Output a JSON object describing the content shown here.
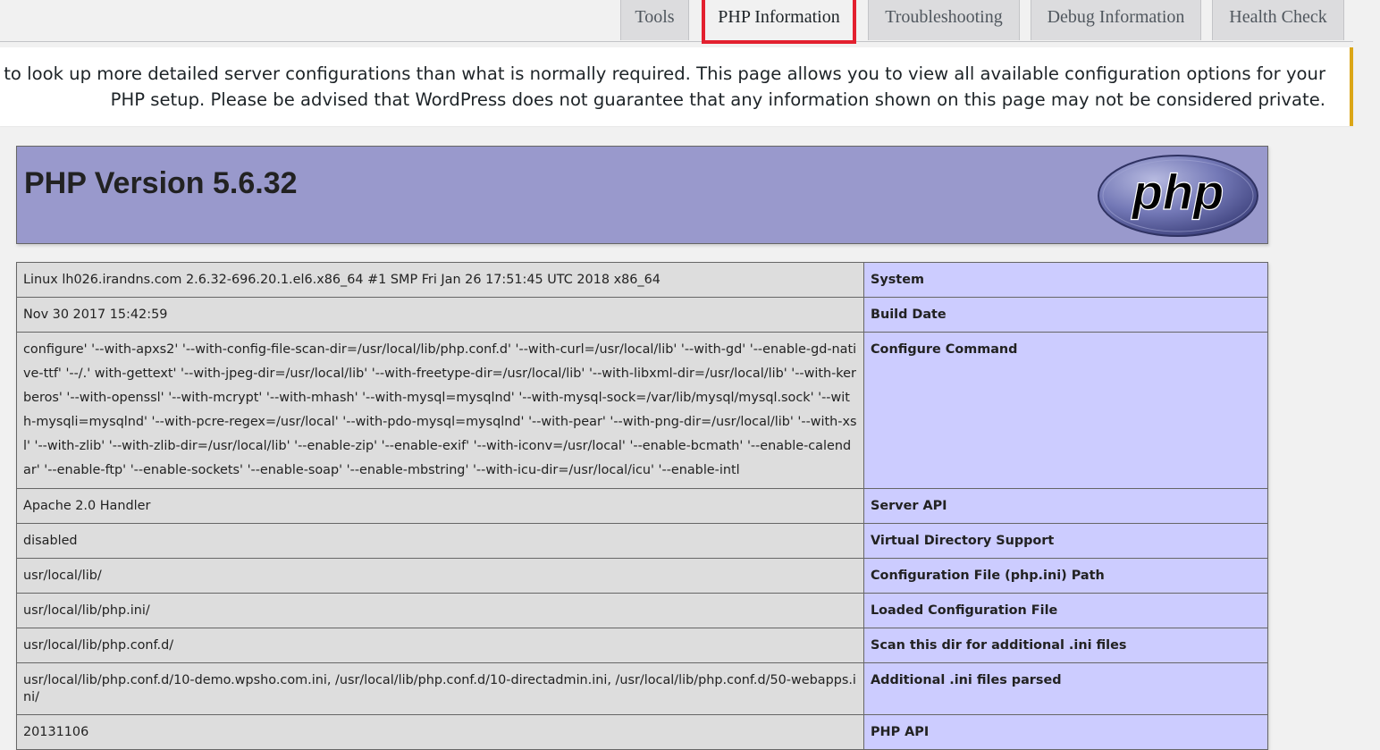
{
  "tabs": {
    "items": [
      {
        "label": "Tools"
      },
      {
        "label": "PHP Information"
      },
      {
        "label": "Troubleshooting"
      },
      {
        "label": "Debug Information"
      },
      {
        "label": "Health Check"
      }
    ],
    "active": "PHP Information"
  },
  "notice": {
    "line1": "scenarios require you to look up more detailed server configurations than what is normally required. This page allows you to view all available configuration options for your",
    "line2": ".PHP setup. Please be advised that WordPress does not guarantee that any information shown on this page may not be considered private"
  },
  "phpinfo": {
    "title": "PHP Version 5.6.32",
    "logo_text": "php",
    "colors": {
      "header_bg": "#9999cc",
      "key_bg": "#ccccff",
      "value_bg": "#dddddd",
      "notice_border": "#dba617",
      "highlight": "#e3202f"
    },
    "rows": [
      {
        "key": "System",
        "value": "Linux lh026.irandns.com 2.6.32-696.20.1.el6.x86_64 #1 SMP Fri Jan 26 17:51:45 UTC 2018 x86_64"
      },
      {
        "key": "Build Date",
        "value": "Nov 30 2017 15:42:59"
      },
      {
        "key": "Configure Command",
        "value": "configure' '--with-apxs2' '--with-config-file-scan-dir=/usr/local/lib/php.conf.d' '--with-curl=/usr/local/lib' '--with-gd' '--enable-gd-native-ttf' '--/.' with-gettext' '--with-jpeg-dir=/usr/local/lib' '--with-freetype-dir=/usr/local/lib' '--with-libxml-dir=/usr/local/lib' '--with-kerberos' '--with-openssl' '--with-mcrypt' '--with-mhash' '--with-mysql=mysqlnd' '--with-mysql-sock=/var/lib/mysql/mysql.sock' '--with-mysqli=mysqlnd' '--with-pcre-regex=/usr/local' '--with-pdo-mysql=mysqlnd' '--with-pear' '--with-png-dir=/usr/local/lib' '--with-xsl' '--with-zlib' '--with-zlib-dir=/usr/local/lib' '--enable-zip' '--enable-exif' '--with-iconv=/usr/local' '--enable-bcmath' '--enable-calendar' '--enable-ftp' '--enable-sockets' '--enable-soap' '--enable-mbstring' '--with-icu-dir=/usr/local/icu' '--enable-intl"
      },
      {
        "key": "Server API",
        "value": "Apache 2.0 Handler"
      },
      {
        "key": "Virtual Directory Support",
        "value": "disabled"
      },
      {
        "key": "Configuration File (php.ini) Path",
        "value": "usr/local/lib/"
      },
      {
        "key": "Loaded Configuration File",
        "value": "usr/local/lib/php.ini/"
      },
      {
        "key": "Scan this dir for additional .ini files",
        "value": "usr/local/lib/php.conf.d/"
      },
      {
        "key": "Additional .ini files parsed",
        "value": "usr/local/lib/php.conf.d/10-demo.wpsho.com.ini, /usr/local/lib/php.conf.d/10-directadmin.ini, /usr/local/lib/php.conf.d/50-webapps.ini/"
      },
      {
        "key": "PHP API",
        "value": "20131106"
      }
    ]
  }
}
